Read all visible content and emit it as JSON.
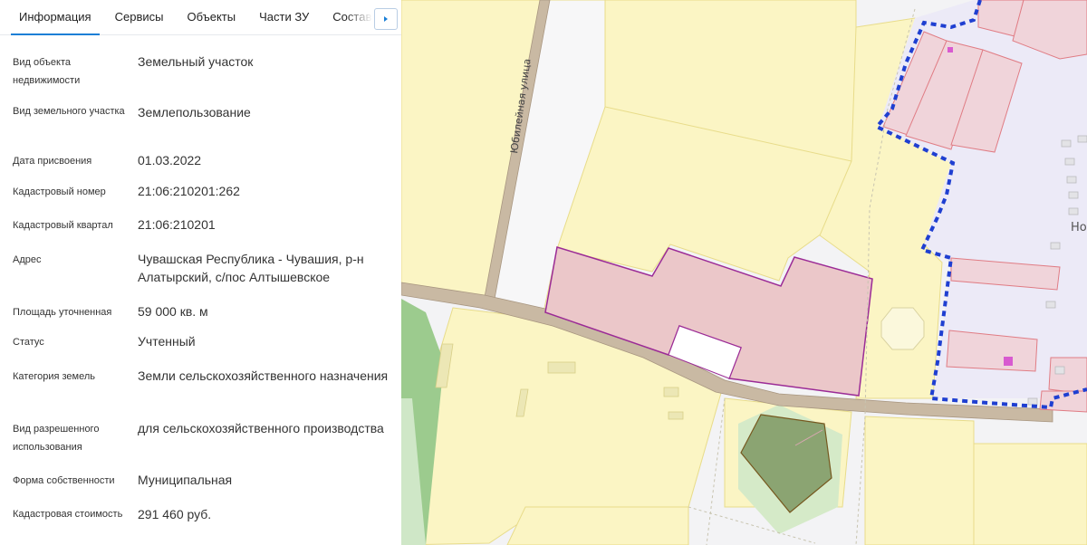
{
  "tabs": [
    {
      "label": "Информация",
      "active": true
    },
    {
      "label": "Сервисы",
      "active": false
    },
    {
      "label": "Объекты",
      "active": false
    },
    {
      "label": "Части ЗУ",
      "active": false
    },
    {
      "label": "Состав",
      "active": false
    }
  ],
  "properties": [
    {
      "label": "Вид объекта недвижимости",
      "value": "Земельный участок"
    },
    {
      "label": "Вид земельного участка",
      "value": "Землепользование"
    },
    {
      "label": "Дата присвоения",
      "value": "01.03.2022"
    },
    {
      "label": "Кадастровый номер",
      "value": "21:06:210201:262"
    },
    {
      "label": "Кадастровый квартал",
      "value": "21:06:210201"
    },
    {
      "label": "Адрес",
      "value": "Чувашская Республика - Чувашия, р-н Алатырский, с/пос Алтышевское"
    },
    {
      "label": "Площадь уточненная",
      "value": "59 000 кв. м"
    },
    {
      "label": "Статус",
      "value": "Учтенный"
    },
    {
      "label": "Категория земель",
      "value": "Земли сельскохозяйственного назначения"
    },
    {
      "label": "Вид разрешенного использования",
      "value": "для сельскохозяйственного производства"
    },
    {
      "label": "Форма собственности",
      "value": "Муниципальная"
    },
    {
      "label": "Кадастровая стоимость",
      "value": "291 460 руб."
    }
  ],
  "map": {
    "street_label": "Юбилейная улица",
    "partial_label": "Но",
    "colors": {
      "parcel_fill": "#fbf5c4",
      "parcel_stroke": "#e8dc8a",
      "selected_fill": "#ebc7c9",
      "selected_stroke": "#9b2b96",
      "building_stroke": "#e07c84",
      "boundary": "#1f3fd1",
      "road": "#c9b9a3",
      "green": "#8ab27a"
    }
  }
}
